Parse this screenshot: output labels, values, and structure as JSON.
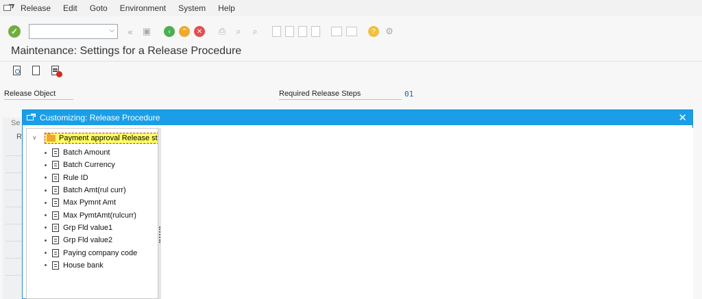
{
  "menubar": {
    "items": [
      "Release",
      "Edit",
      "Goto",
      "Environment",
      "System",
      "Help"
    ]
  },
  "toolbar": {
    "command_field_value": "",
    "icons": [
      "ok-check-icon",
      "command-dropdown-icon",
      "back-arrows-icon",
      "save-icon",
      "nav-back-icon",
      "nav-exit-icon",
      "cancel-icon",
      "print-icon",
      "find-icon",
      "find-next-icon",
      "first-page-icon",
      "prev-page-icon",
      "next-page-icon",
      "last-page-icon",
      "new-session-icon",
      "shortcut-icon",
      "help-icon",
      "customize-layout-icon"
    ]
  },
  "page": {
    "title": "Maintenance: Settings for a Release Procedure"
  },
  "app_toolbar": {
    "icons": [
      "display-detail-icon",
      "new-entries-icon",
      "delete-icon"
    ]
  },
  "fields": {
    "release_object_label": "Release Object",
    "required_steps_label": "Required Release Steps",
    "required_steps_value": "01"
  },
  "background_table": {
    "header_1": "Se",
    "header_2": "R"
  },
  "dialog": {
    "title": "Customizing: Release Procedure",
    "close_glyph": "✕",
    "tree": {
      "root_label": "Payment approval Release stru",
      "items": [
        "Batch Amount",
        "Batch Currency",
        "Rule ID",
        "Batch Amt(rul curr)",
        "Max Pymnt Amt",
        "Max PymtAmt(rulcurr)",
        "Grp Fld value1",
        "Grp Fld value2",
        "Paying company code",
        "House bank"
      ]
    }
  },
  "colors": {
    "dialog_header": "#1a9ee8",
    "root_highlight": "#ffff66",
    "ok_green": "#6fae3c",
    "value_blue": "#1f5fa8"
  }
}
